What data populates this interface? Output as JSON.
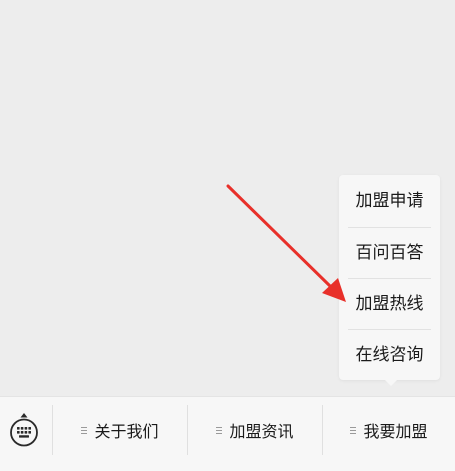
{
  "popup_menu": {
    "items": [
      {
        "label": "加盟申请"
      },
      {
        "label": "百问百答"
      },
      {
        "label": "加盟热线"
      },
      {
        "label": "在线咨询"
      }
    ]
  },
  "menu_bar": {
    "keyboard_icon": "keyboard-icon",
    "tabs": [
      {
        "label": "关于我们",
        "icon": "menu-lines-icon"
      },
      {
        "label": "加盟资讯",
        "icon": "menu-lines-icon"
      },
      {
        "label": "我要加盟",
        "icon": "menu-lines-icon"
      }
    ]
  },
  "annotation": {
    "arrow_color": "#e8302a",
    "points_to": "加盟热线"
  },
  "colors": {
    "background": "#ededed",
    "menu_background": "#f7f7f7",
    "text": "#1a1a1a"
  }
}
